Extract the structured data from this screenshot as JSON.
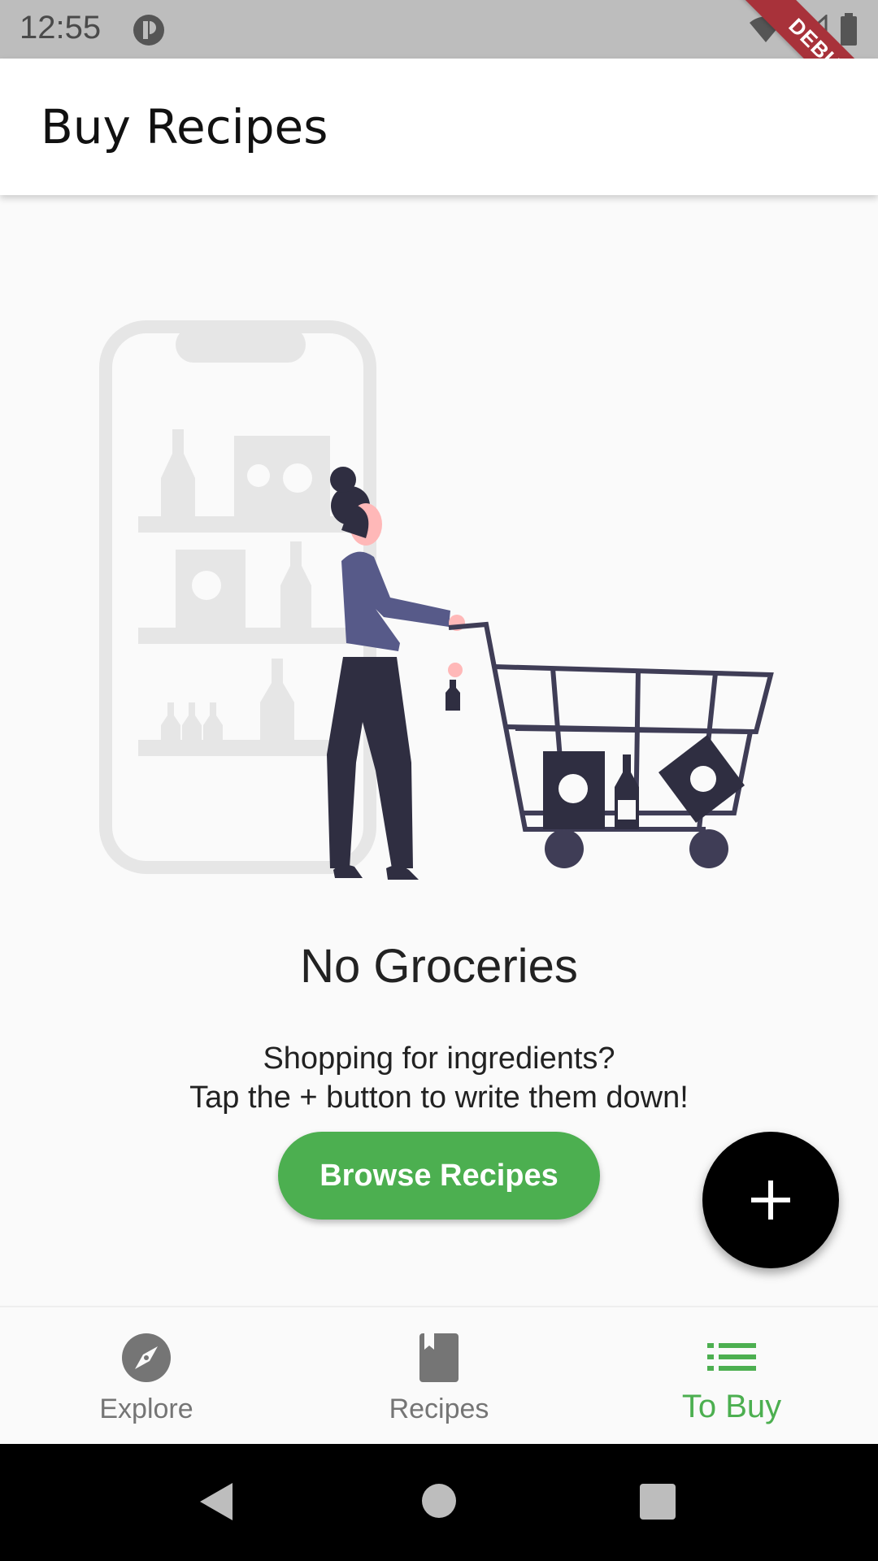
{
  "status_bar": {
    "time": "12:55",
    "debug_label": "DEBUG"
  },
  "app_bar": {
    "title": "Buy Recipes"
  },
  "empty_state": {
    "title": "No Groceries",
    "subtitle": "Shopping for ingredients?\nTap the + button to write them down!",
    "button_label": "Browse Recipes"
  },
  "fab": {
    "icon": "plus-icon"
  },
  "bottom_nav": {
    "items": [
      {
        "label": "Explore",
        "icon": "compass-icon",
        "active": false
      },
      {
        "label": "Recipes",
        "icon": "book-icon",
        "active": false
      },
      {
        "label": "To Buy",
        "icon": "list-icon",
        "active": true
      }
    ]
  },
  "colors": {
    "accent": "#4caf50",
    "app_bar": "#ffffff",
    "background": "#fafafa",
    "fab": "#000000",
    "inactive": "#757575",
    "illustration_dark": "#2f2e41",
    "illustration_purple": "#575a89"
  }
}
